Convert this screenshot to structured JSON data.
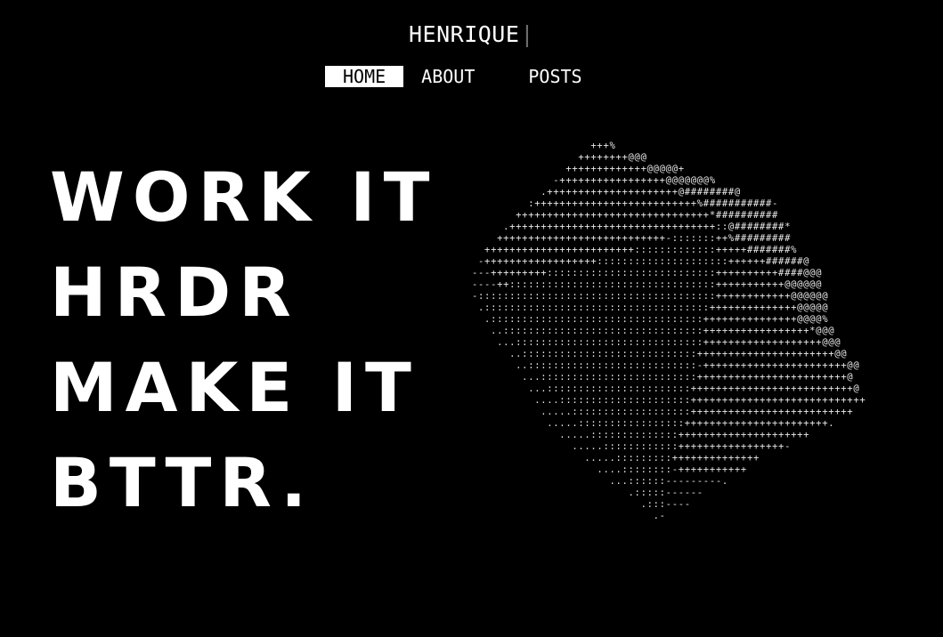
{
  "header": {
    "brand": "HENRIQUE",
    "cursor": "|"
  },
  "nav": {
    "items": [
      {
        "label": "HOME",
        "active": true
      },
      {
        "label": "ABOUT",
        "active": false
      },
      {
        "label": "POSTS",
        "active": false
      }
    ]
  },
  "hero": {
    "lines": [
      "WORK IT",
      "HRDR",
      "MAKE IT",
      "BTTR."
    ]
  },
  "ascii_art": {
    "lines": [
      "                   +++%",
      "                 ++++++++@@@",
      "               +++++++++++++@@@@@+",
      "             -+++++++++++++++++@@@@@@@%",
      "           .+++++++++++++++++++++@########@",
      "         :++++++++++++++++++++++++++%###########-",
      "       +++++++++++++++++++++++++++++++*##########",
      "     .+++++++++++++++++++++++++++++++++::@########*",
      "    +++++++++++++++++++++++++++-:::::::++%#########",
      "  ++++++++++++++++++++++++:::::::::::::+++++#######%",
      " -++++++++++++++++++:::::::::::::::::::::++++++######@",
      "---+++++++++:::::::::::::::::::::::::::++++++++++####@@@",
      "----++:::::::::::::::::::::::::::::::::+++++++++++@@@@@@",
      "-::::::::::::::::::::::::::::::::::::::++++++++++++@@@@@@",
      " .::::::::::::::::::::::::::::::::::::++++++++++++++@@@@@",
      "  .::::::::::::::::::::::::::::::::::+++++++++++++++@@@@%",
      "   ..::::::::::::::::::::::::::::::::+++++++++++++++++*@@@",
      "    ...::::::::::::::::::::::::::::::+++++++++++++++++++@@@",
      "      ..::::::::::::::::::::::::::::++++++++++++++++++++++@@",
      "       ..:::::::::::::::::::::::::::-+++++++++++++++++++++++@@",
      "        ...:::::::::::::::::::::::::++++++++++++++++++++++++@",
      "         ...:::::::::::::::::::::::++++++++++++++++++++++++++@",
      "          ....:::::::::::::::::::::++++++++++++++++++++++++++++",
      "           .....:::::::::::::::::::++++++++++++++++++++++++++",
      "            .....:::::::::::::::::+++++++++++++++++++++++.",
      "              .....::::::::::::::+++++++++++++++++++++",
      "                .....::::::::::::+++++++++++++++++-",
      "                  .....:::::::::++++++++++++++",
      "                    ....::::::::-+++++++++++",
      "                      ...::::::---------.",
      "                         .:::::------",
      "                           .:::----",
      "                             .-"
    ]
  }
}
